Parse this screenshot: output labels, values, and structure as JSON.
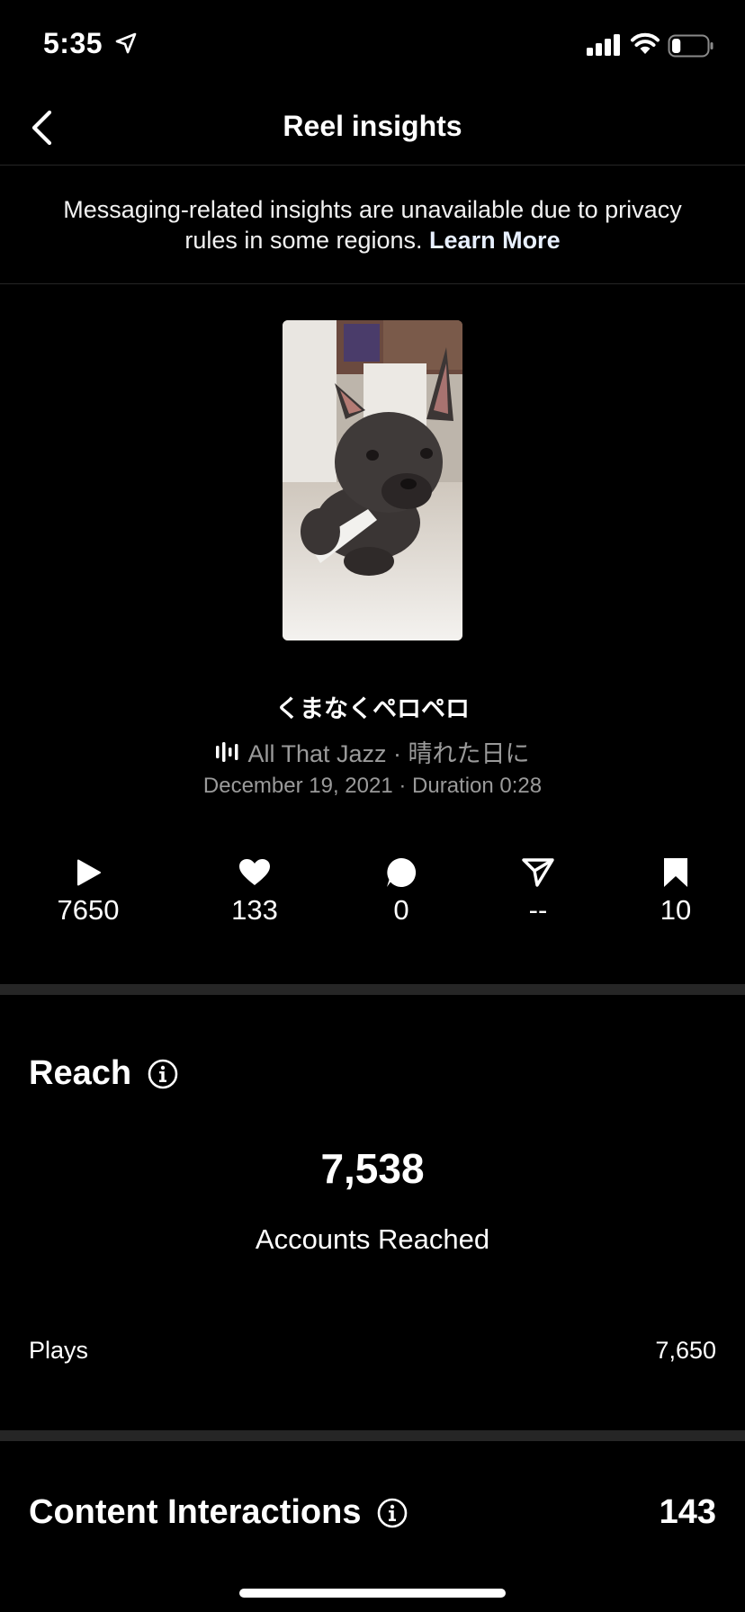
{
  "status_bar": {
    "time": "5:35",
    "battery_level": 0.25
  },
  "nav": {
    "title": "Reel insights"
  },
  "notice": {
    "text": "Messaging-related insights are unavailable due to privacy rules in some regions.",
    "link": "Learn More"
  },
  "reel": {
    "title": "くまなくペロペロ",
    "audio": "All That Jazz · 晴れた日に",
    "meta": "December 19, 2021 · Duration 0:28"
  },
  "stats": [
    {
      "icon": "play-icon",
      "value": "7650"
    },
    {
      "icon": "heart-icon",
      "value": "133"
    },
    {
      "icon": "comment-icon",
      "value": "0"
    },
    {
      "icon": "share-icon",
      "value": "--"
    },
    {
      "icon": "bookmark-icon",
      "value": "10"
    }
  ],
  "reach": {
    "title": "Reach",
    "accounts_reached": "7,538",
    "accounts_label": "Accounts Reached",
    "plays_label": "Plays",
    "plays_value": "7,650"
  },
  "content_interactions": {
    "title": "Content Interactions",
    "value": "143"
  },
  "colors": {
    "background": "#000000",
    "divider": "#262626",
    "secondary_text": "#9a9a9a"
  }
}
